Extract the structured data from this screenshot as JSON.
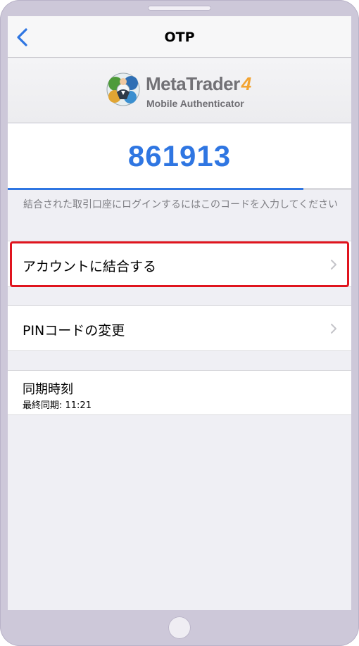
{
  "navbar": {
    "title": "OTP"
  },
  "logo": {
    "title": "MetaTrader",
    "version": "4",
    "subtitle": "Mobile Authenticator"
  },
  "otp": {
    "code": "861913",
    "progress": 0.86
  },
  "hint": "結合された取引口座にログインするにはこのコードを入力してください",
  "menu": {
    "link_account": "アカウントに結合する",
    "change_pin": "PINコードの変更"
  },
  "sync": {
    "label": "同期時刻",
    "last_sync": "最終同期: 11:21"
  },
  "colors": {
    "accent": "#2f76e2",
    "highlight": "#e0141e",
    "logo_four": "#f2a331"
  }
}
